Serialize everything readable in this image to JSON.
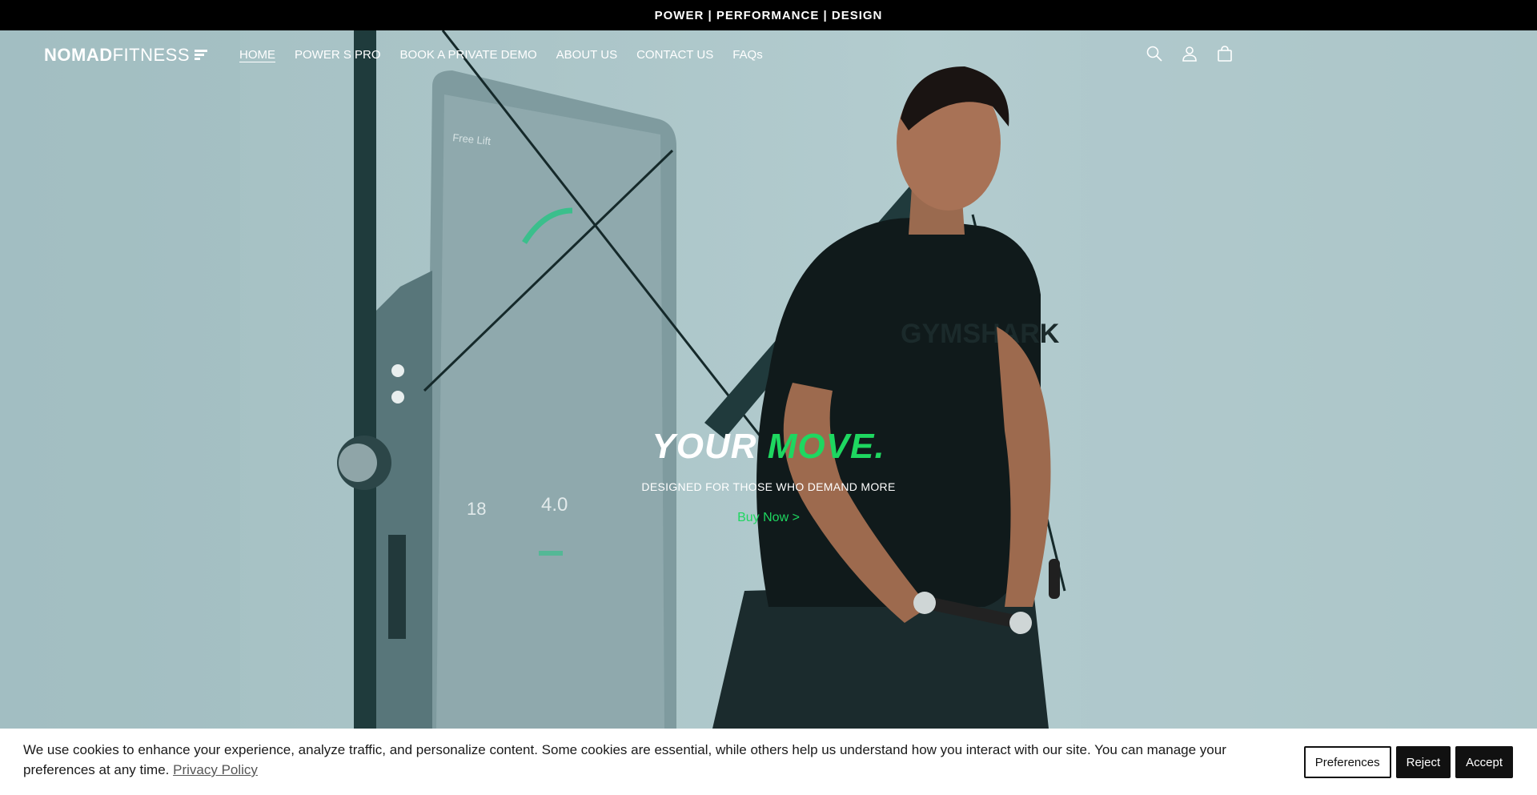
{
  "announcement": {
    "text": "POWER | PERFORMANCE | DESIGN"
  },
  "logo": {
    "bold": "NOMAD",
    "light": "FITNESS"
  },
  "nav": {
    "items": [
      {
        "label": "HOME",
        "active": true
      },
      {
        "label": "POWER S PRO",
        "active": false
      },
      {
        "label": "BOOK A PRIVATE DEMO",
        "active": false
      },
      {
        "label": "ABOUT US",
        "active": false
      },
      {
        "label": "CONTACT US",
        "active": false
      },
      {
        "label": "FAQs",
        "active": false
      }
    ]
  },
  "header_icons": [
    "search-icon",
    "account-icon",
    "cart-icon"
  ],
  "hero": {
    "headline_part1": "YOUR",
    "headline_part2": "MOVE.",
    "subline": "DESIGNED FOR THOSE WHO DEMAND MORE",
    "cta": "Buy Now >",
    "screen_text": "Free Lift",
    "screen_numbers": [
      "18",
      "4.0"
    ],
    "shirt_text": "GYMSHARK"
  },
  "cookie": {
    "message": "We use cookies to enhance your experience, analyze traffic, and personalize content. Some cookies are essential, while others help us understand how you interact with our site. You can manage your preferences at any time.",
    "policy_link": "Privacy Policy",
    "buttons": {
      "preferences": "Preferences",
      "reject": "Reject",
      "accept": "Accept"
    }
  },
  "colors": {
    "accent": "#1ed760",
    "topbar": "#000000",
    "hero_bg": "#a9c3c6"
  }
}
